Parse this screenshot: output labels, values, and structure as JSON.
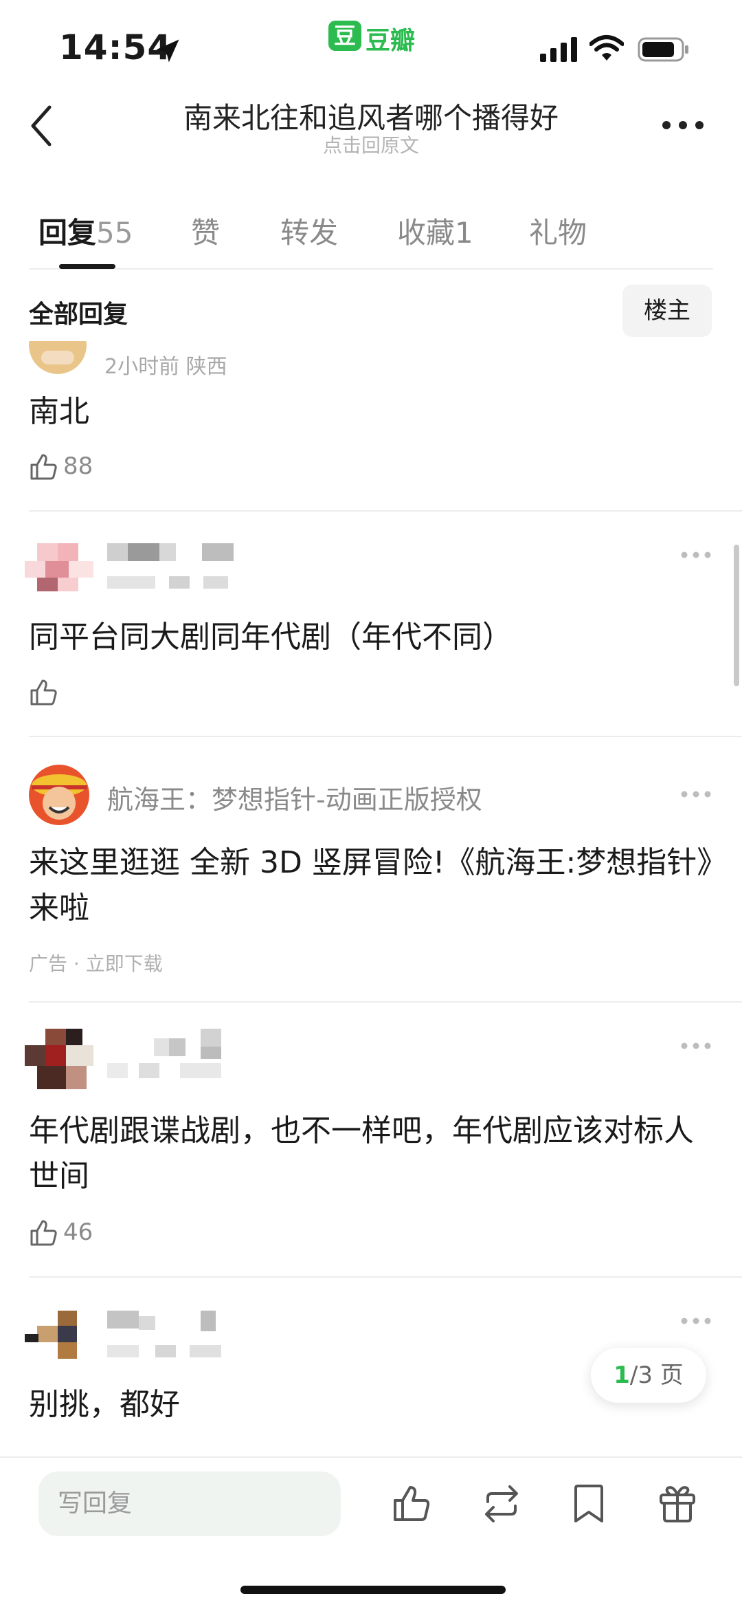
{
  "status_bar": {
    "time": "14:54",
    "app_badge": "豆",
    "app_name": "豆瓣"
  },
  "header": {
    "title": "南来北往和追风者哪个播得好",
    "subtitle": "点击回原文"
  },
  "tabs": [
    {
      "label": "回复",
      "count": "55",
      "active": true
    },
    {
      "label": "赞",
      "count": ""
    },
    {
      "label": "转发",
      "count": ""
    },
    {
      "label": "收藏",
      "count": "1"
    },
    {
      "label": "礼物",
      "count": ""
    }
  ],
  "filter": {
    "all_label": "全部回复",
    "op_label": "楼主"
  },
  "comments": [
    {
      "meta": "2小时前 陕西",
      "text": "南北",
      "likes": "88"
    },
    {
      "text": "同平台同大剧同年代剧（年代不同）",
      "likes": ""
    },
    {
      "text": "年代剧跟谍战剧，也不一样吧，年代剧应该对标人",
      "text2": "世间",
      "likes": "46"
    },
    {
      "text": "别挑，都好"
    }
  ],
  "ad": {
    "name": "航海王：梦想指针-动画正版授权",
    "text": "来这里逛逛 全新 3D 竖屏冒险!《航海王:梦想指针》",
    "text2": "来啦",
    "label": "广告 · 立即下载"
  },
  "pagination": {
    "current": "1",
    "rest": "/3 页"
  },
  "bottom_bar": {
    "reply_placeholder": "写回复"
  },
  "colors": {
    "accent": "#2bbb4f",
    "text": "#1a1a1a",
    "muted": "#a8a8a8"
  }
}
